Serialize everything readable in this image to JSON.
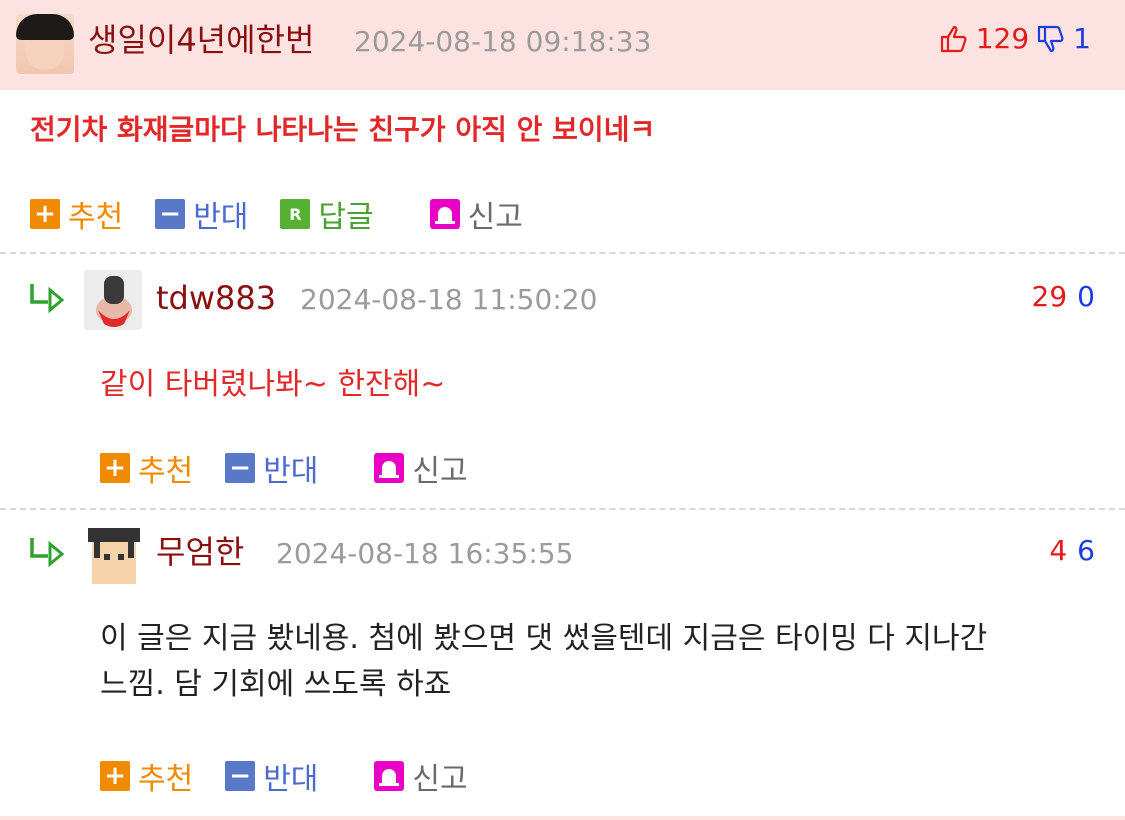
{
  "main_comment": {
    "username": "생일이4년에한번",
    "timestamp": "2024-08-18 09:18:33",
    "upvotes": "129",
    "downvotes": "1",
    "text": "전기차 화재글마다 나타나는 친구가 아직 안 보이네ㅋ",
    "actions": {
      "recommend": "추천",
      "oppose": "반대",
      "reply": "답글",
      "report": "신고"
    },
    "icons": {
      "upvote": "thumbs-up-icon",
      "downvote": "thumbs-down-icon",
      "reply_badge": "R"
    }
  },
  "replies": [
    {
      "username": "tdw883",
      "timestamp": "2024-08-18 11:50:20",
      "upvotes": "29",
      "downvotes": "0",
      "text": "같이 타버렸나봐~ 한잔해~",
      "text_color": "#e22929",
      "actions": {
        "recommend": "추천",
        "oppose": "반대",
        "report": "신고"
      }
    },
    {
      "username": "무엄한",
      "timestamp": "2024-08-18 16:35:55",
      "upvotes": "4",
      "downvotes": "6",
      "text_line1": "이 글은 지금 봤네용. 첨에 봤으면 댓 썼을텐데 지금은 타이밍 다 지나간",
      "text_line2": "느낌. 담 기회에 쓰도록 하죠",
      "text_color": "#222222",
      "actions": {
        "recommend": "추천",
        "oppose": "반대",
        "report": "신고"
      }
    }
  ],
  "colors": {
    "header_bg": "#fde2e2",
    "username": "#8a0f0f",
    "upvote": "#e51a1a",
    "downvote": "#1a3ee0",
    "recommend": "#f08a00",
    "oppose": "#4a6ad0",
    "reply": "#4aa12c",
    "report_icon": "#e800c4"
  }
}
